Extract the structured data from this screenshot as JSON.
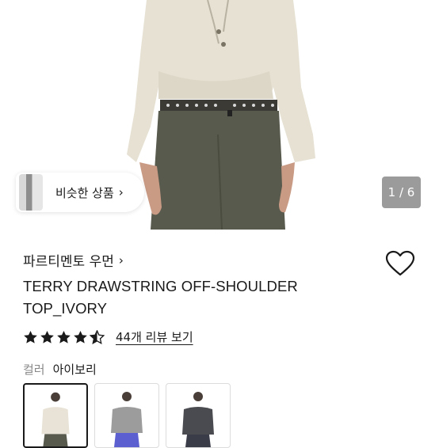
{
  "hero": {
    "image": "model-wearing-ivory-drawstring-top",
    "similar_products_label": "비슷한 상품",
    "page_counter": "1 / 6"
  },
  "product": {
    "brand": "파르티멘토 우먼",
    "title_line1": "TERRY DRAWSTRING OFF-SHOULDER",
    "title_line2": "TOP_IVORY",
    "rating": 4.5,
    "review_link": "44개 리뷰 보기"
  },
  "options": {
    "color_label": "컬러",
    "color_value": "아이보리",
    "swatches": [
      {
        "color": "#e8e3d6",
        "selected": true
      },
      {
        "color": "#9c9c9c",
        "selected": false
      },
      {
        "color": "#4a4b50",
        "selected": false
      }
    ]
  },
  "colors": {
    "text": "#1a1a1a",
    "muted": "#888888",
    "counter_bg": "#9b9b9b"
  }
}
